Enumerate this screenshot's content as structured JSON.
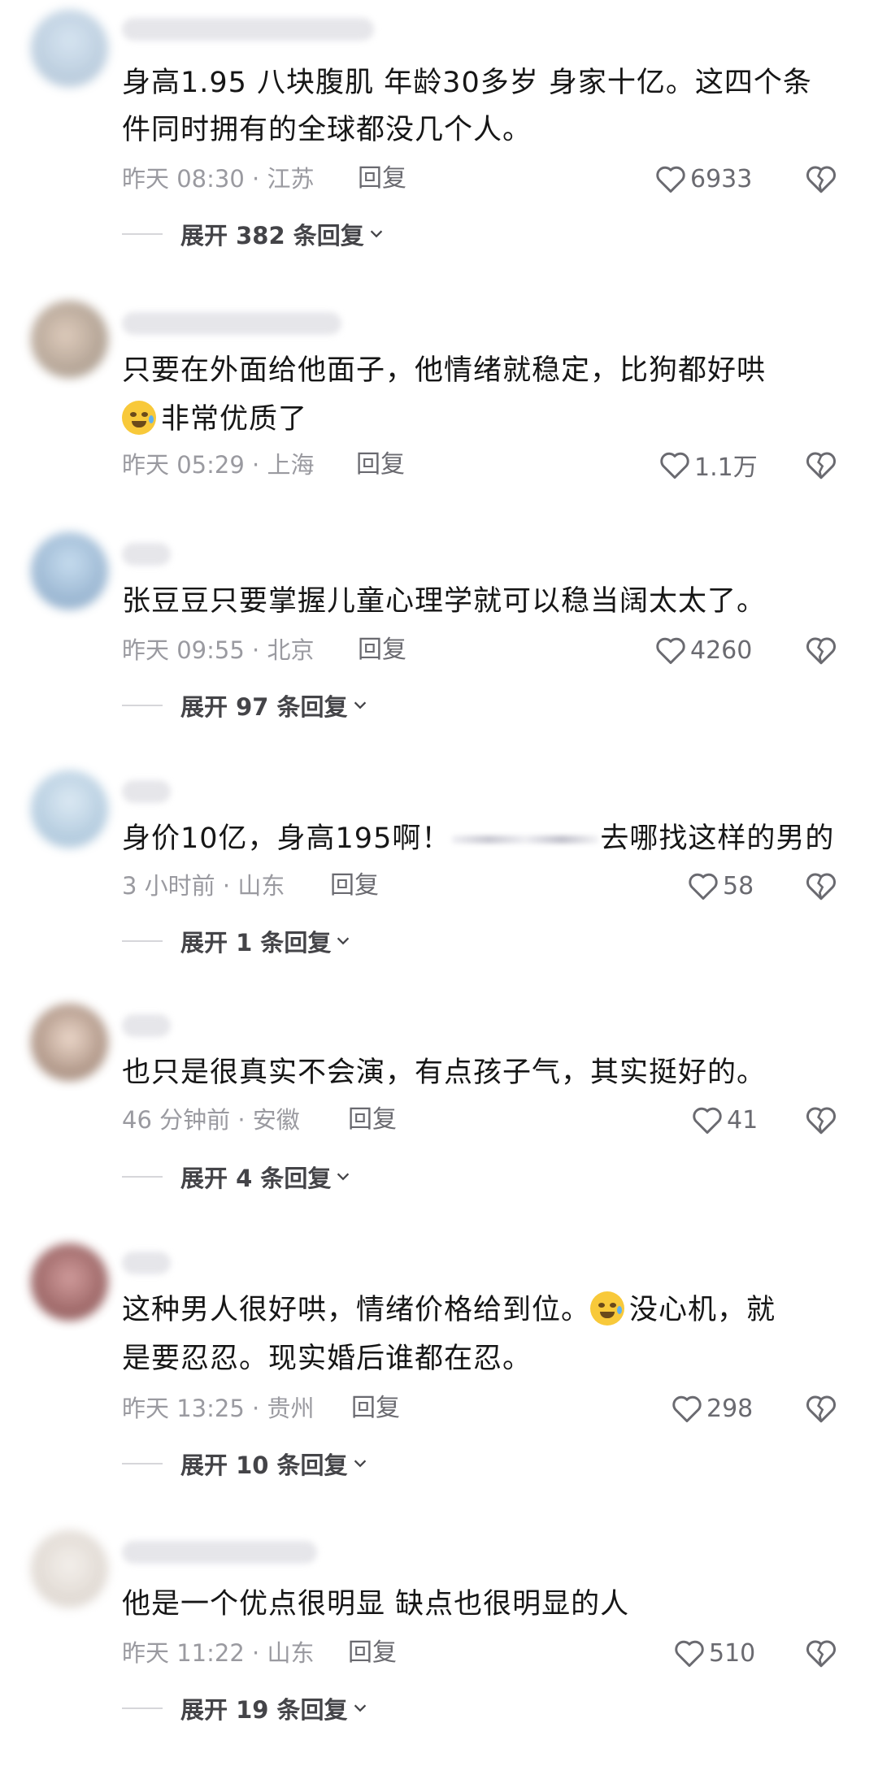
{
  "comments": [
    {
      "lines": [
        "身高1.95 八块腹肌 年龄30多岁  身家十亿。这四个条",
        "件同时拥有的全球都没几个人。"
      ],
      "time_location": "昨天 08:30 · 江苏",
      "reply_label": "回复",
      "likes": "6933",
      "expand_label": "展开 382 条回复"
    },
    {
      "lines": [
        "只要在外面给他面子，他情绪就稳定，比狗都好哄",
        "非常优质了"
      ],
      "time_location": "昨天 05:29 · 上海",
      "reply_label": "回复",
      "likes": "1.1万"
    },
    {
      "lines": [
        "张豆豆只要掌握儿童心理学就可以稳当阔太太了。"
      ],
      "time_location": "昨天 09:55 · 北京",
      "reply_label": "回复",
      "likes": "4260",
      "expand_label": "展开 97 条回复"
    },
    {
      "lines": [
        "身价10亿，身高195啊！",
        "去哪找这样的男的"
      ],
      "time_location": "3 小时前 · 山东",
      "reply_label": "回复",
      "likes": "58",
      "expand_label": "展开 1 条回复"
    },
    {
      "lines": [
        "也只是很真实不会演，有点孩子气，其实挺好的。"
      ],
      "time_location": "46 分钟前 · 安徽",
      "reply_label": "回复",
      "likes": "41",
      "expand_label": "展开 4 条回复"
    },
    {
      "lines": [
        "这种男人很好哄，情绪价格给到位。",
        "没心机，就",
        "是要忍忍。现实婚后谁都在忍。"
      ],
      "time_location": "昨天 13:25 · 贵州",
      "reply_label": "回复",
      "likes": "298",
      "expand_label": "展开 10 条回复"
    },
    {
      "lines": [
        "他是一个优点很明显 缺点也很明显的人"
      ],
      "time_location": "昨天 11:22 · 山东",
      "reply_label": "回复",
      "likes": "510",
      "expand_label": "展开 19 条回复"
    }
  ],
  "icons": {
    "like": "heart-outline-icon",
    "dislike": "broken-heart-icon",
    "expand": "chevron-down-icon",
    "emoji_1": "crying-face-emoji",
    "emoji_2": "laughing-tears-emoji"
  },
  "colors": {
    "text": "#161616",
    "meta": "#9a9aa0",
    "action": "#6a6a70",
    "background": "#ffffff"
  }
}
